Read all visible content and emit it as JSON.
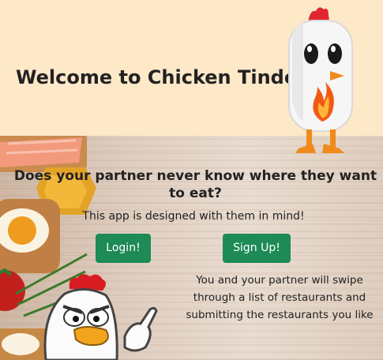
{
  "header": {
    "title": "Welcome to Chicken Tinder!",
    "mascot_icon": "chicken-mascot-icon",
    "background_color": "#fde8c8"
  },
  "hero": {
    "question": "Does your partner never know where they want to eat?",
    "tagline": "This app is designed with them in mind!",
    "login_label": "Login!",
    "signup_label": "Sign Up!",
    "description": "You and your partner will swipe through a list of restaurants and submitting the restaurants you like",
    "button_color": "#1e8a56"
  }
}
